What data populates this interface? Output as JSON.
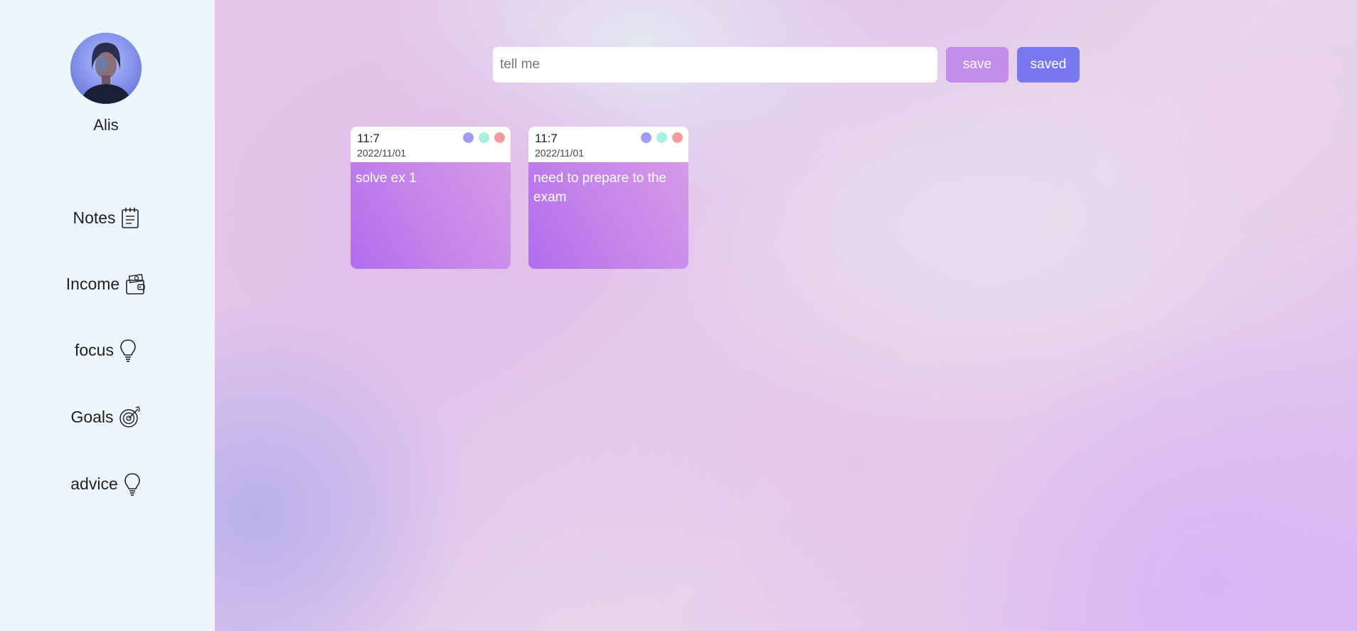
{
  "user": {
    "name": "Alis"
  },
  "nav": {
    "items": [
      {
        "label": "Notes",
        "icon": "notepad-icon"
      },
      {
        "label": "Income",
        "icon": "wallet-icon"
      },
      {
        "label": "focus",
        "icon": "lightbulb-icon"
      },
      {
        "label": "Goals",
        "icon": "target-icon"
      },
      {
        "label": "advice",
        "icon": "lightbulb-icon"
      }
    ]
  },
  "composer": {
    "placeholder": "tell me",
    "value": "",
    "save_label": "save",
    "saved_label": "saved"
  },
  "colors": {
    "sidebar_bg": "#eef6fd",
    "save_button": "#c38ee9",
    "saved_button": "#7a78f1",
    "dot_blue": "#a09cf6",
    "dot_mint": "#a8f0df",
    "dot_red": "#f49ba0",
    "note_body": "#b26bee"
  },
  "notes": [
    {
      "time": "11:7",
      "date": "2022/11/01",
      "text": "solve ex 1"
    },
    {
      "time": "11:7",
      "date": "2022/11/01",
      "text": "need to prepare to the exam"
    }
  ]
}
